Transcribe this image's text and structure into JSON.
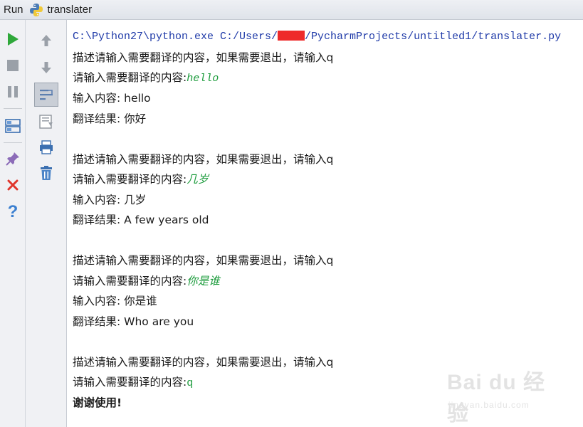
{
  "window": {
    "run_label": "Run",
    "tab_title": "translater"
  },
  "console": {
    "command_prefix": "C:\\Python27\\python.exe C:/Users/",
    "command_suffix": "/PycharmProjects/untitled1/translater.py",
    "blocks": [
      {
        "description": "描述请输入需要翻译的内容，如果需要退出，请输入q",
        "prompt": "请输入需要翻译的内容:",
        "user_input": "hello",
        "echo": "输入内容: hello",
        "result": "翻译结果: 你好"
      },
      {
        "description": "描述请输入需要翻译的内容，如果需要退出，请输入q",
        "prompt": "请输入需要翻译的内容:",
        "user_input": "几岁",
        "echo": "输入内容: 几岁",
        "result": "翻译结果: A few years old"
      },
      {
        "description": "描述请输入需要翻译的内容，如果需要退出，请输入q",
        "prompt": "请输入需要翻译的内容:",
        "user_input": "你是谁",
        "echo": "输入内容: 你是谁",
        "result": "翻译结果: Who are you"
      },
      {
        "description": "描述请输入需要翻译的内容，如果需要退出，请输入q",
        "prompt": "请输入需要翻译的内容:",
        "user_input": "q",
        "farewell": "谢谢使用!"
      }
    ]
  },
  "toolbar": {
    "left": [
      "run-icon",
      "stop-icon",
      "pause-icon",
      "layout-icon",
      "pin-icon",
      "close-icon",
      "help-icon"
    ],
    "right": [
      "up-arrow-icon",
      "down-arrow-icon",
      "soft-wrap-icon",
      "scroll-to-end-icon",
      "print-icon",
      "trash-icon"
    ]
  },
  "watermark": {
    "logo": "Bai du 经验",
    "url": "jingyan.baidu.com"
  },
  "colors": {
    "command": "#1f3aa8",
    "user_input": "#1b9b3b",
    "run_green": "#2fa83a",
    "close_red": "#e0352b",
    "help_blue": "#3b7fd0"
  }
}
